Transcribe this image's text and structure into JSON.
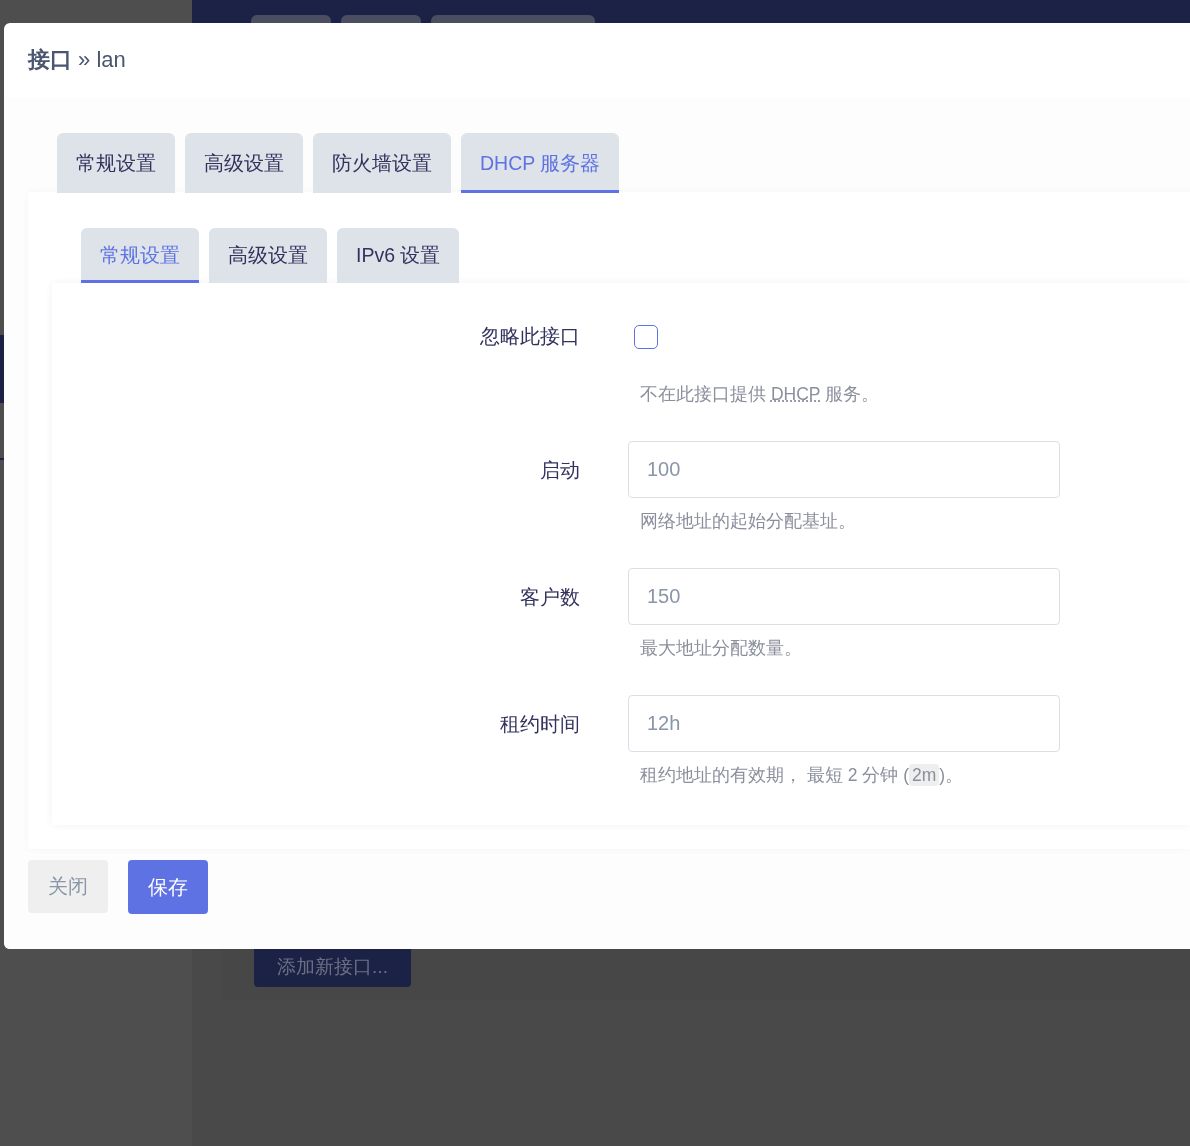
{
  "page": {
    "add_button": "添加新接口..."
  },
  "dialog": {
    "title": "**接口** » lan",
    "tabs": [
      {
        "label": "常规设置",
        "selected": false
      },
      {
        "label": "高级设置",
        "selected": false
      },
      {
        "label": "防火墙设置",
        "selected": false
      },
      {
        "label": "DHCP 服务器",
        "selected": true
      }
    ],
    "subtabs": [
      {
        "label": "常规设置",
        "selected": true
      },
      {
        "label": "高级设置",
        "selected": false
      },
      {
        "label": "IPv6 设置",
        "selected": false
      }
    ],
    "fields": [
      {
        "kind": "checkbox",
        "label": "忽略此接口",
        "checked": false,
        "description": [
          {
            "kind": "text",
            "text": "不在此接口提供 "
          },
          {
            "kind": "abbr",
            "text": "DHCP"
          },
          {
            "kind": "text",
            "text": " 服务。"
          }
        ]
      },
      {
        "kind": "text",
        "label": "启动",
        "placeholder": "100",
        "description": [
          {
            "kind": "text",
            "text": "网络地址的起始分配基址。"
          }
        ]
      },
      {
        "kind": "text",
        "label": "客户数",
        "placeholder": "150",
        "description": [
          {
            "kind": "text",
            "text": "最大地址分配数量。"
          }
        ]
      },
      {
        "kind": "text",
        "label": "租约时间",
        "placeholder": "12h",
        "description": [
          {
            "kind": "text",
            "text": "租约地址的有效期， 最短 2 分钟 ("
          },
          {
            "kind": "code",
            "text": "2m"
          },
          {
            "kind": "text",
            "text": ")。"
          }
        ]
      }
    ],
    "buttons": [
      {
        "kind": "secondary",
        "label": "关闭"
      },
      {
        "kind": "primary",
        "label": "保存"
      }
    ]
  }
}
